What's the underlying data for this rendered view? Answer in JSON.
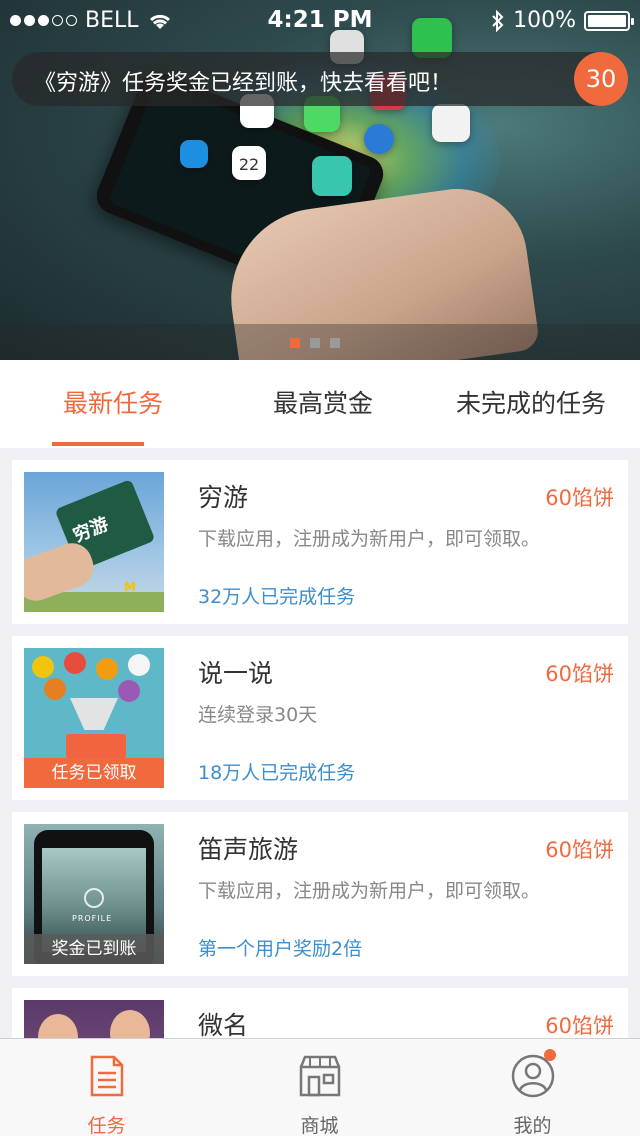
{
  "status_bar": {
    "carrier": "BELL",
    "time": "4:21 PM",
    "battery": "100%",
    "battery_level": 1.0,
    "signal_bars": 3
  },
  "banner": {
    "notice_text": "《穷游》任务奖金已经到账，快去看看吧！",
    "notice_count": "30",
    "calendar_day": "22",
    "carousel_page": 1,
    "carousel_total": 3
  },
  "tabs": [
    {
      "label": "最新任务",
      "active": true
    },
    {
      "label": "最高赏金",
      "active": false
    },
    {
      "label": "未完成的任务",
      "active": false
    }
  ],
  "tasks": [
    {
      "title": "穷游",
      "reward": "60馅饼",
      "desc": "下载应用，注册成为新用户，即可领取。",
      "stat": "32万人已完成任务",
      "tag": "",
      "thumb_text": "穷游"
    },
    {
      "title": "说一说",
      "reward": "60馅饼",
      "desc": "连续登录30天",
      "stat": "18万人已完成任务",
      "tag": "任务已领取"
    },
    {
      "title": "笛声旅游",
      "reward": "60馅饼",
      "desc": "下载应用，注册成为新用户，即可领取。",
      "stat": "第一个用户奖励2倍",
      "tag": "奖金已到账",
      "thumb_text": "PROFILE"
    },
    {
      "title": "微名",
      "reward": "60馅饼",
      "desc": "",
      "stat": "",
      "tag": ""
    }
  ],
  "bottom_nav": [
    {
      "label": "任务",
      "icon": "document-icon",
      "active": true
    },
    {
      "label": "商城",
      "icon": "store-icon",
      "active": false
    },
    {
      "label": "我的",
      "icon": "user-icon",
      "active": false,
      "has_badge": true
    }
  ],
  "colors": {
    "accent": "#f06a3e",
    "link": "#3b8fd0",
    "tag_orange": "#f06a3e",
    "tag_gray": "#6f6f6f"
  }
}
